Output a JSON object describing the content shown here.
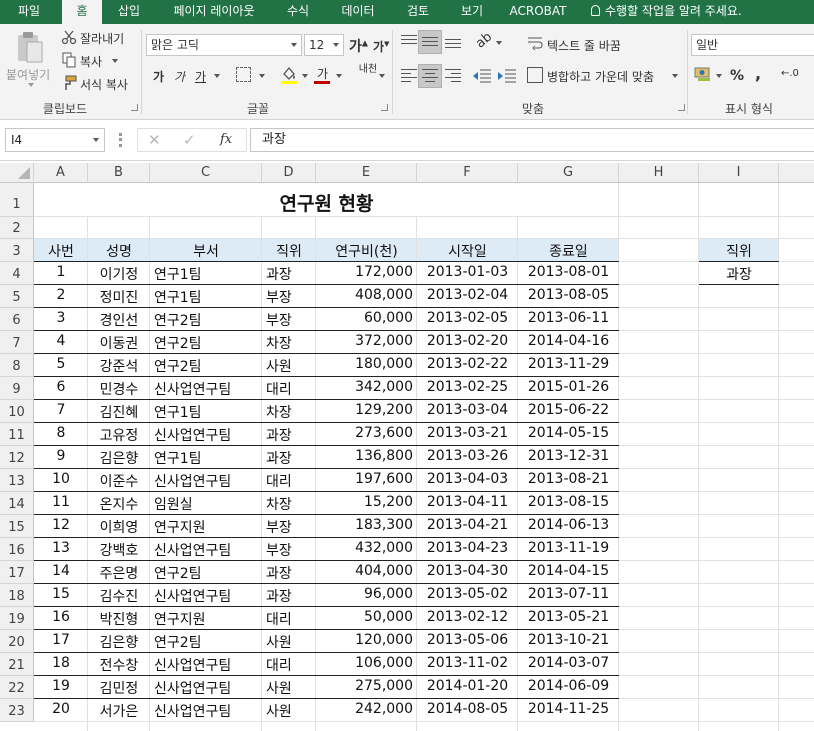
{
  "tabs": [
    "파일",
    "홈",
    "삽입",
    "페이지 레이아웃",
    "수식",
    "데이터",
    "검토",
    "보기",
    "ACROBAT"
  ],
  "tell_me": "수행할 작업을 알려 주세요.",
  "ribbon": {
    "clipboard": {
      "paste": "붙여넣기",
      "cut": "잘라내기",
      "copy": "복사",
      "format_painter": "서식 복사",
      "label": "클립보드"
    },
    "font": {
      "name": "맑은 고딕",
      "size": "12",
      "bold": "가",
      "italic": "가",
      "underline": "가",
      "phonetic": "내천",
      "label": "글꼴"
    },
    "align": {
      "wrap": "텍스트 줄 바꿈",
      "merge": "병합하고 가운데 맞춤",
      "label": "맞춤"
    },
    "number": {
      "format": "일반",
      "percent": "%",
      "comma": ",",
      "label": "표시 형식"
    }
  },
  "formula_bar": {
    "cell_ref": "I4",
    "fx": "fx",
    "value": "과장"
  },
  "columns": [
    "A",
    "B",
    "C",
    "D",
    "E",
    "F",
    "G",
    "H",
    "I"
  ],
  "rows": [
    "1",
    "2",
    "3",
    "4",
    "5",
    "6",
    "7",
    "8",
    "9",
    "10",
    "11",
    "12",
    "13",
    "14",
    "15",
    "16",
    "17",
    "18",
    "19",
    "20",
    "21",
    "22",
    "23"
  ],
  "sheet": {
    "title": "연구원 현황",
    "headers": [
      "사번",
      "성명",
      "부서",
      "직위",
      "연구비(천)",
      "시작일",
      "종료일"
    ],
    "records": [
      [
        "1",
        "이기정",
        "연구1팀",
        "과장",
        "172,000",
        "2013-01-03",
        "2013-08-01"
      ],
      [
        "2",
        "정미진",
        "연구1팀",
        "부장",
        "408,000",
        "2013-02-04",
        "2013-08-05"
      ],
      [
        "3",
        "경인선",
        "연구2팀",
        "부장",
        "60,000",
        "2013-02-05",
        "2013-06-11"
      ],
      [
        "4",
        "이동권",
        "연구2팀",
        "차장",
        "372,000",
        "2013-02-20",
        "2014-04-16"
      ],
      [
        "5",
        "강준석",
        "연구2팀",
        "사원",
        "180,000",
        "2013-02-22",
        "2013-11-29"
      ],
      [
        "6",
        "민경수",
        "신사업연구팀",
        "대리",
        "342,000",
        "2013-02-25",
        "2015-01-26"
      ],
      [
        "7",
        "김진혜",
        "연구1팀",
        "차장",
        "129,200",
        "2013-03-04",
        "2015-06-22"
      ],
      [
        "8",
        "고유정",
        "신사업연구팀",
        "과장",
        "273,600",
        "2013-03-21",
        "2014-05-15"
      ],
      [
        "9",
        "김은향",
        "연구1팀",
        "과장",
        "136,800",
        "2013-03-26",
        "2013-12-31"
      ],
      [
        "10",
        "이준수",
        "신사업연구팀",
        "대리",
        "197,600",
        "2013-04-03",
        "2013-08-21"
      ],
      [
        "11",
        "온지수",
        "임원실",
        "차장",
        "15,200",
        "2013-04-11",
        "2013-08-15"
      ],
      [
        "12",
        "이희영",
        "연구지원",
        "부장",
        "183,300",
        "2013-04-21",
        "2014-06-13"
      ],
      [
        "13",
        "강백호",
        "신사업연구팀",
        "부장",
        "432,000",
        "2013-04-23",
        "2013-11-19"
      ],
      [
        "14",
        "주은명",
        "연구2팀",
        "과장",
        "404,000",
        "2013-04-30",
        "2014-04-15"
      ],
      [
        "15",
        "김수진",
        "신사업연구팀",
        "과장",
        "96,000",
        "2013-05-02",
        "2013-07-11"
      ],
      [
        "16",
        "박진형",
        "연구지원",
        "대리",
        "50,000",
        "2013-02-12",
        "2013-05-21"
      ],
      [
        "17",
        "김은향",
        "연구2팀",
        "사원",
        "120,000",
        "2013-05-06",
        "2013-10-21"
      ],
      [
        "18",
        "전수창",
        "신사업연구팀",
        "대리",
        "106,000",
        "2013-11-02",
        "2014-03-07"
      ],
      [
        "19",
        "김민정",
        "신사업연구팀",
        "사원",
        "275,000",
        "2014-01-20",
        "2014-06-09"
      ],
      [
        "20",
        "서가은",
        "신사업연구팀",
        "사원",
        "242,000",
        "2014-08-05",
        "2014-11-25"
      ]
    ],
    "criteria_header": "직위",
    "criteria_value": "과장"
  },
  "colors": {
    "accent": "#217346",
    "header_fill": "#ddebf7",
    "font_red": "#c00000",
    "fill_yellow": "#ffff00"
  }
}
